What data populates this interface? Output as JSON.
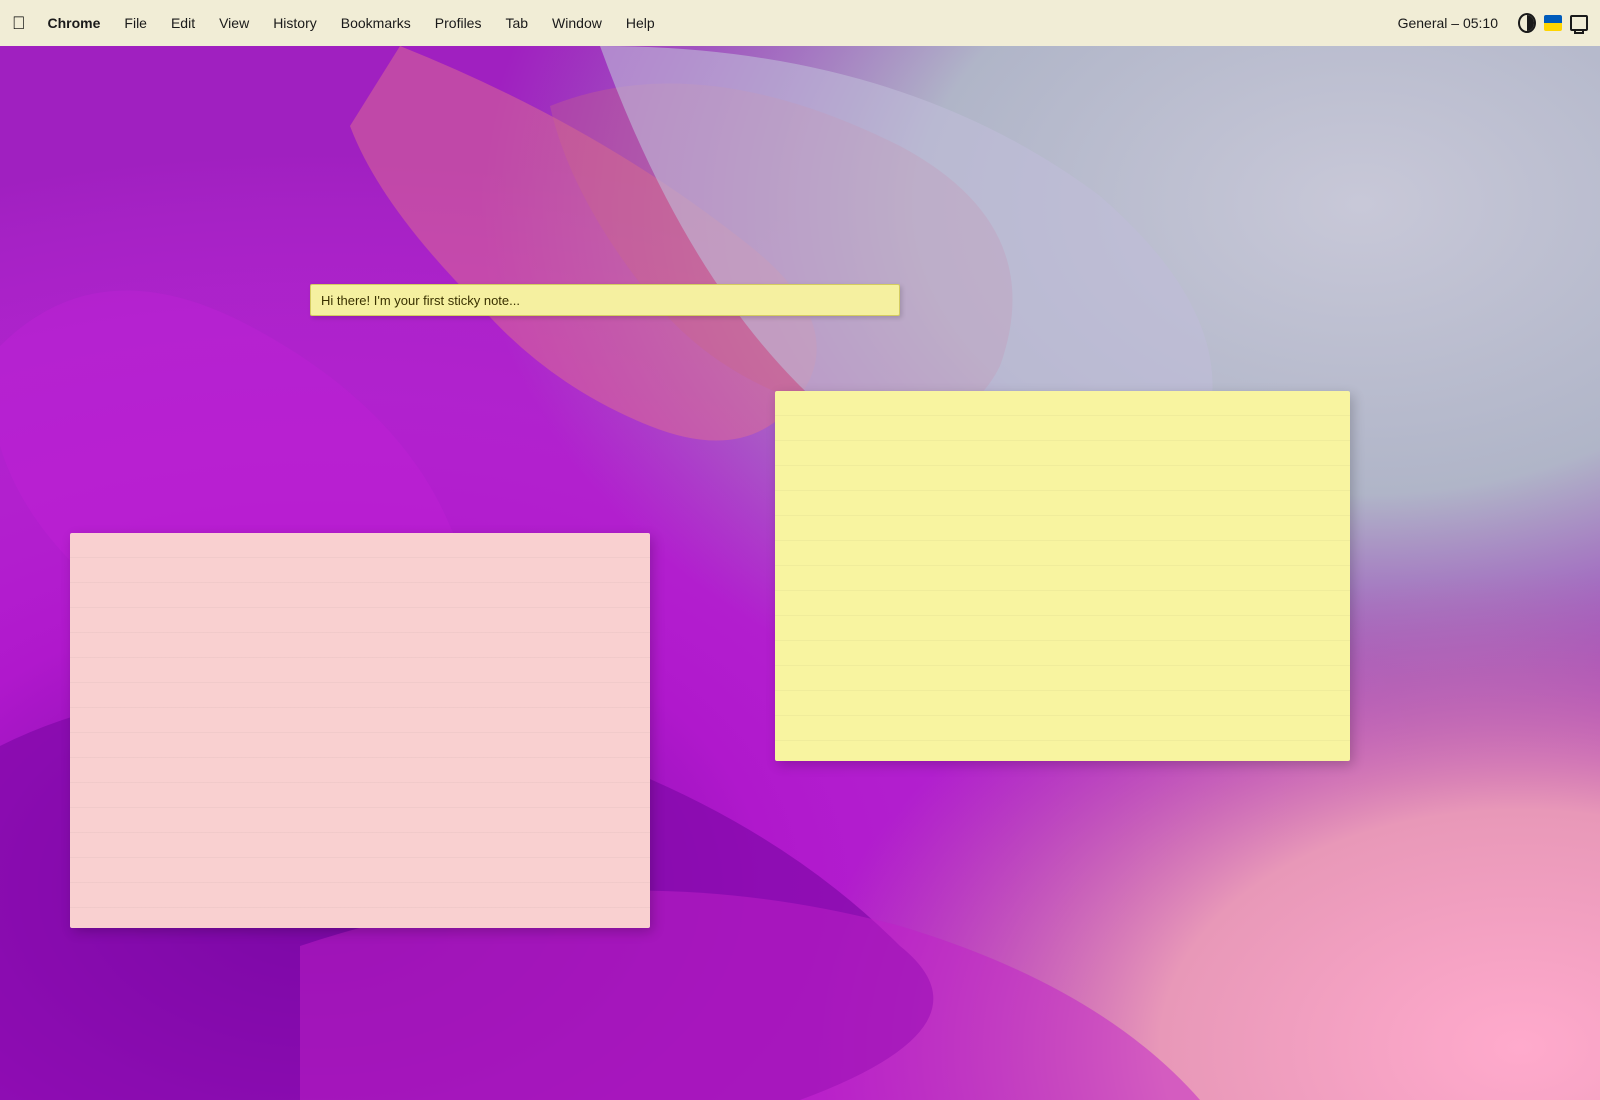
{
  "menubar": {
    "apple_symbol": "🍎",
    "items": [
      {
        "label": "Chrome",
        "bold": true
      },
      {
        "label": "File"
      },
      {
        "label": "Edit"
      },
      {
        "label": "View"
      },
      {
        "label": "History"
      },
      {
        "label": "Bookmarks"
      },
      {
        "label": "Profiles"
      },
      {
        "label": "Tab"
      },
      {
        "label": "Window"
      },
      {
        "label": "Help"
      }
    ],
    "clock": "General – 05:10"
  },
  "sticky_notes": {
    "small": {
      "text": "Hi there! I'm your first sticky note..."
    },
    "yellow": {
      "text": ""
    },
    "pink": {
      "text": ""
    }
  }
}
